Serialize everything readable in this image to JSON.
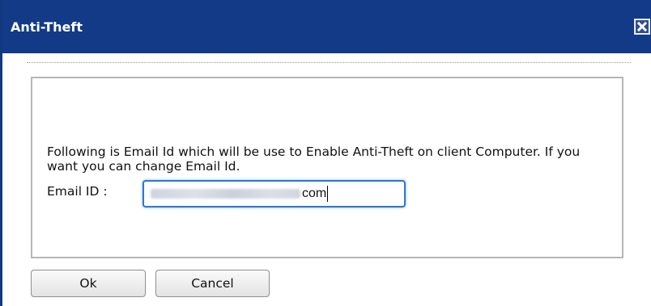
{
  "dialog": {
    "title": "Anti-Theft",
    "close_icon": "close-icon",
    "message": "Following is Email Id which will be use to Enable Anti-Theft on client Computer. If you want you can change Email Id.",
    "email_label": "Email ID :",
    "email_value_visible_suffix": "com",
    "ok_label": "Ok",
    "cancel_label": "Cancel"
  },
  "colors": {
    "titlebar": "#123a86",
    "title_text": "#ffffff",
    "input_focus_border": "#2a78d8"
  }
}
